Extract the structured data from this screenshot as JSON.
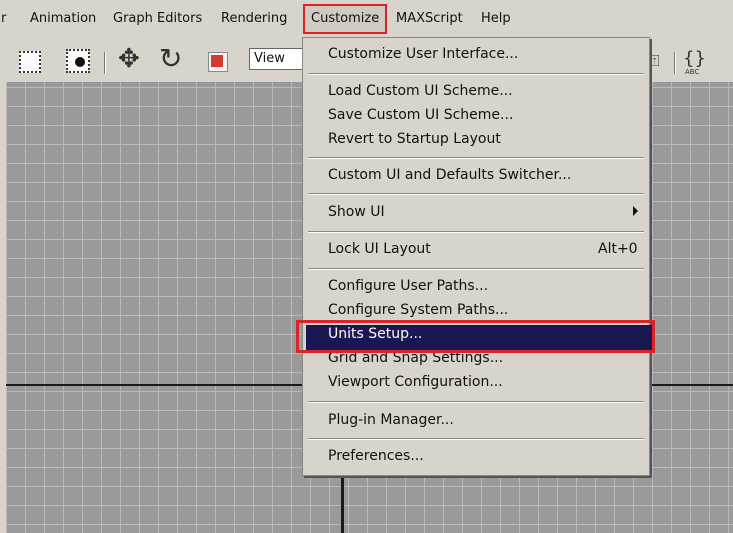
{
  "menubar": {
    "cut_item": "r",
    "items": [
      "Animation",
      "Graph Editors",
      "Rendering",
      "Customize",
      "MAXScript",
      "Help"
    ]
  },
  "toolbar": {
    "view_field": "View",
    "icons": [
      "select-region-icon",
      "select-object-icon",
      "move-icon",
      "rotate-icon",
      "scale-icon",
      "align-icon",
      "abc-icon"
    ]
  },
  "dropdown": {
    "items": {
      "customize_ui": "Customize User Interface...",
      "load_scheme": "Load Custom UI Scheme...",
      "save_scheme": "Save Custom UI Scheme...",
      "revert_layout": "Revert to Startup Layout",
      "switcher": "Custom UI and Defaults Switcher...",
      "show_ui": "Show UI",
      "lock_ui": "Lock UI Layout",
      "lock_ui_shortcut": "Alt+0",
      "user_paths": "Configure User Paths...",
      "system_paths": "Configure System Paths...",
      "units_setup": "Units Setup...",
      "grid_snap": "Grid and Snap Settings...",
      "viewport_config": "Viewport Configuration...",
      "plugin_manager": "Plug-in Manager...",
      "preferences": "Preferences..."
    }
  },
  "colors": {
    "highlight": "#1a1852",
    "annotation_red": "#d9242a",
    "menu_bg": "#d8d4cc",
    "viewport_bg": "#9a9a9a"
  }
}
